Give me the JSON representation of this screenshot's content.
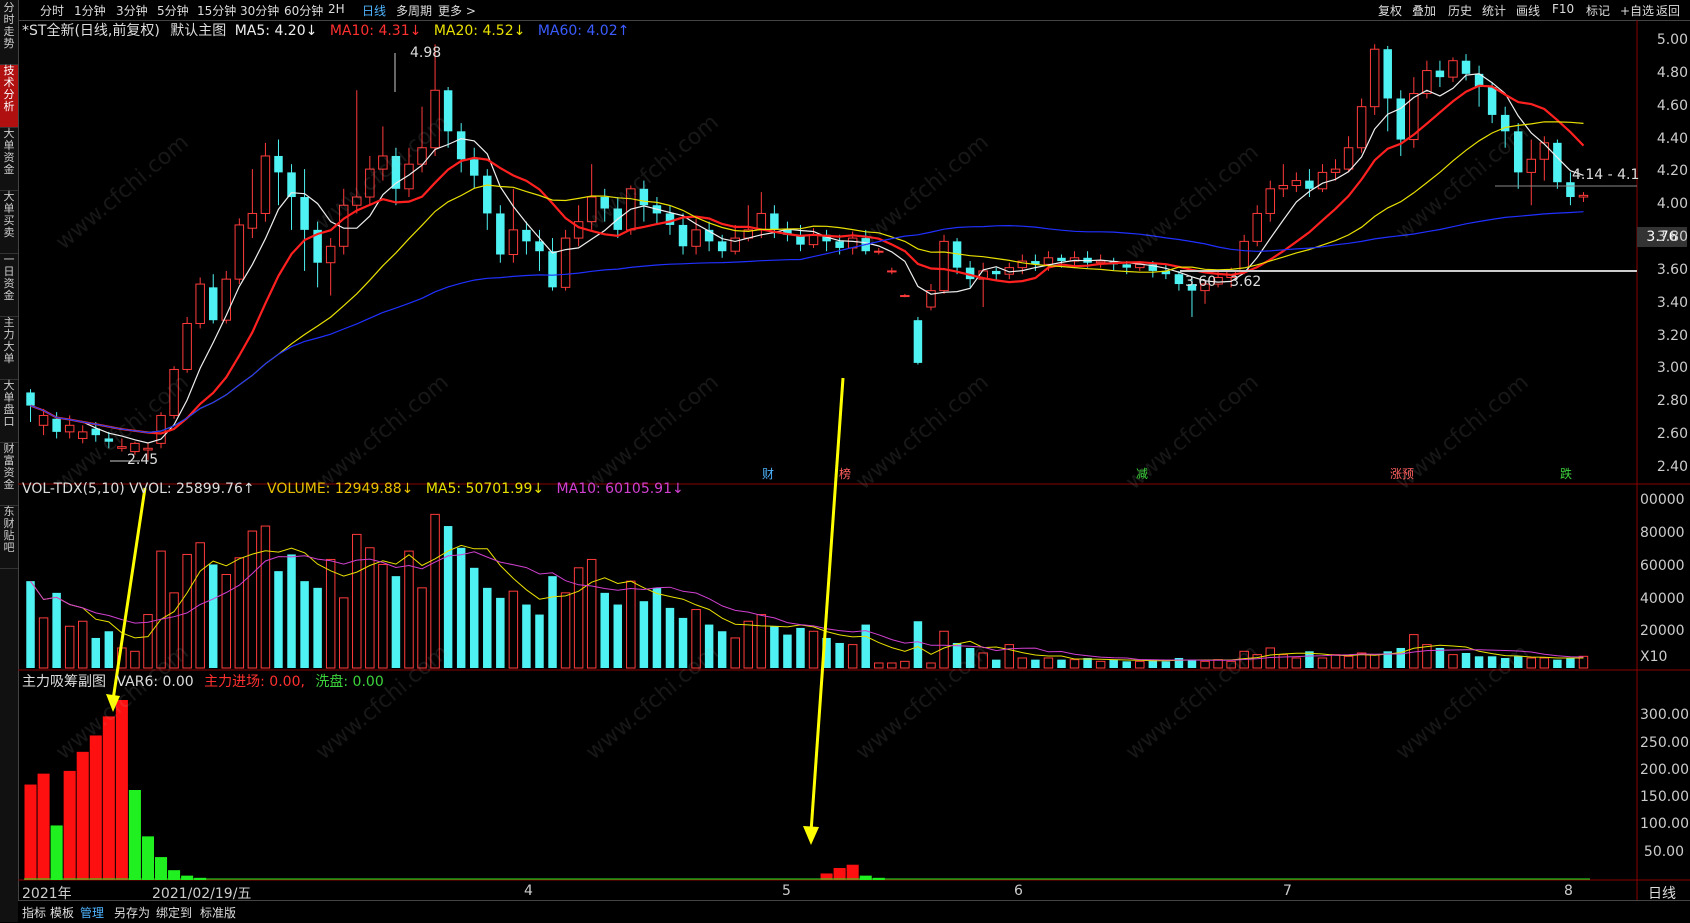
{
  "sidebar": {
    "items": [
      {
        "label": "分时走势",
        "active": false
      },
      {
        "label": "技术分析",
        "active": true
      },
      {
        "label": "大单资金",
        "active": false
      },
      {
        "label": "大单买卖",
        "active": false
      },
      {
        "label": "一日资金",
        "active": false
      },
      {
        "label": "主力大单",
        "active": false
      },
      {
        "label": "大单盘口",
        "active": false
      },
      {
        "label": "财富资金",
        "active": false
      },
      {
        "label": "东财贴吧",
        "active": false
      }
    ]
  },
  "topbar": {
    "periods": [
      "分时",
      "1分钟",
      "3分钟",
      "5分钟",
      "15分钟",
      "30分钟",
      "60分钟",
      "2H",
      "日线",
      "多周期",
      "更多 >"
    ],
    "active_period": "日线",
    "right_buttons": [
      "复权",
      "叠加",
      "历史",
      "统计",
      "画线",
      "F10",
      "标记",
      "+自选",
      "返回"
    ]
  },
  "main_panel": {
    "stock_title": "*ST全新(日线,前复权)",
    "indicator_name": "默认主图",
    "ma5": "MA5: 4.20↓",
    "ma10": "MA10: 4.31↓",
    "ma20": "MA20: 4.52↓",
    "ma60": "MA60: 4.02↑",
    "price_axis": [
      "5.00",
      "4.80",
      "4.60",
      "4.40",
      "4.20",
      "4.00",
      "3.80",
      "3.60",
      "3.40",
      "3.20",
      "3.00",
      "2.80",
      "2.60",
      "2.40"
    ],
    "current_price_tag": "3.76",
    "annotation_high": "4.98",
    "annotation_low": "2.45",
    "annotation_range1": "3.60 - 3.62",
    "annotation_range2": "4.14 - 4.1",
    "events": [
      {
        "label": "财",
        "color": "#4fb4ff"
      },
      {
        "label": "榜",
        "color": "#ff6060"
      },
      {
        "label": "减",
        "color": "#3cd23c"
      },
      {
        "label": "涨预",
        "color": "#ff6060"
      },
      {
        "label": "跌",
        "color": "#3cd23c"
      }
    ]
  },
  "volume_panel": {
    "title": "VOL-TDX(5,10)",
    "vvol": "VVOL: 25899.76↑",
    "volume": "VOLUME: 12949.88↓",
    "ma5": "MA5: 50701.99↓",
    "ma10": "MA10: 60105.91↓",
    "axis": [
      "00000",
      "80000",
      "60000",
      "40000",
      "20000",
      "X10"
    ]
  },
  "indicator_panel": {
    "title": "主力吸筹副图",
    "var6": "VAR6: 0.00",
    "main_entry": "主力进场: 0.00,",
    "wash": "洗盘: 0.00",
    "axis": [
      "300.00",
      "250.00",
      "200.00",
      "150.00",
      "100.00",
      "50.00"
    ]
  },
  "date_axis": {
    "labels": [
      "2021年",
      "2021/02/19/五",
      "4",
      "5",
      "6",
      "7",
      "8"
    ],
    "period_label": "日线"
  },
  "bottombar": {
    "items": [
      "指标",
      "模板",
      "管理",
      "另存为",
      "绑定到",
      "标准版"
    ],
    "active": "管理"
  },
  "watermark": "www.cfchi.com",
  "chart_data": {
    "type": "candlestick",
    "price_range": [
      2.4,
      5.0
    ],
    "candles": [
      [
        2.86,
        2.78,
        2.88,
        2.68
      ],
      [
        2.66,
        2.72,
        2.76,
        2.6
      ],
      [
        2.7,
        2.62,
        2.74,
        2.58
      ],
      [
        2.62,
        2.66,
        2.72,
        2.58
      ],
      [
        2.58,
        2.62,
        2.66,
        2.55
      ],
      [
        2.64,
        2.6,
        2.68,
        2.56
      ],
      [
        2.58,
        2.56,
        2.62,
        2.52
      ],
      [
        2.52,
        2.53,
        2.58,
        2.5
      ],
      [
        2.5,
        2.55,
        2.56,
        2.48
      ],
      [
        2.51,
        2.52,
        2.55,
        2.45
      ],
      [
        2.55,
        2.72,
        2.74,
        2.52
      ],
      [
        2.72,
        3.0,
        3.02,
        2.7
      ],
      [
        3.0,
        3.28,
        3.32,
        2.98
      ],
      [
        3.28,
        3.52,
        3.56,
        3.25
      ],
      [
        3.5,
        3.3,
        3.58,
        3.28
      ],
      [
        3.3,
        3.55,
        3.6,
        3.28
      ],
      [
        3.55,
        3.88,
        3.92,
        3.52
      ],
      [
        3.86,
        3.95,
        4.22,
        3.8
      ],
      [
        3.95,
        4.3,
        4.38,
        3.9
      ],
      [
        4.3,
        4.2,
        4.4,
        4.0
      ],
      [
        4.2,
        4.05,
        4.25,
        3.85
      ],
      [
        4.05,
        3.85,
        4.22,
        3.6
      ],
      [
        3.85,
        3.65,
        3.9,
        3.5
      ],
      [
        3.65,
        3.75,
        3.8,
        3.45
      ],
      [
        3.75,
        4.0,
        4.1,
        3.7
      ],
      [
        4.0,
        4.05,
        4.7,
        3.95
      ],
      [
        4.05,
        4.22,
        4.3,
        4.0
      ],
      [
        4.22,
        4.3,
        4.48,
        4.15
      ],
      [
        4.3,
        4.1,
        4.35,
        4.0
      ],
      [
        4.1,
        4.25,
        4.35,
        4.05
      ],
      [
        4.25,
        4.35,
        4.6,
        4.2
      ],
      [
        4.35,
        4.7,
        4.98,
        4.3
      ],
      [
        4.7,
        4.45,
        4.72,
        4.35
      ],
      [
        4.45,
        4.28,
        4.5,
        4.2
      ],
      [
        4.28,
        4.18,
        4.35,
        4.1
      ],
      [
        4.18,
        3.95,
        4.22,
        3.85
      ],
      [
        3.95,
        3.7,
        4.0,
        3.65
      ],
      [
        3.7,
        3.85,
        4.1,
        3.65
      ],
      [
        3.85,
        3.78,
        3.9,
        3.7
      ],
      [
        3.78,
        3.72,
        3.85,
        3.6
      ],
      [
        3.72,
        3.5,
        3.8,
        3.48
      ],
      [
        3.5,
        3.8,
        3.85,
        3.48
      ],
      [
        3.8,
        3.9,
        4.0,
        3.75
      ],
      [
        3.9,
        4.05,
        4.25,
        3.85
      ],
      [
        4.05,
        3.98,
        4.1,
        3.9
      ],
      [
        3.98,
        3.85,
        4.05,
        3.8
      ],
      [
        3.85,
        4.1,
        4.12,
        3.82
      ],
      [
        4.1,
        4.0,
        4.15,
        3.9
      ],
      [
        4.0,
        3.95,
        4.05,
        3.88
      ],
      [
        3.95,
        3.88,
        4.0,
        3.82
      ],
      [
        3.88,
        3.75,
        3.95,
        3.7
      ],
      [
        3.75,
        3.85,
        3.92,
        3.7
      ],
      [
        3.85,
        3.78,
        3.9,
        3.72
      ],
      [
        3.78,
        3.72,
        3.82,
        3.68
      ],
      [
        3.72,
        3.8,
        3.88,
        3.7
      ],
      [
        3.8,
        3.85,
        4.0,
        3.78
      ],
      [
        3.85,
        3.95,
        4.08,
        3.8
      ],
      [
        3.95,
        3.85,
        4.0,
        3.8
      ],
      [
        3.85,
        3.82,
        3.9,
        3.78
      ],
      [
        3.82,
        3.76,
        3.88,
        3.72
      ],
      [
        3.76,
        3.82,
        3.86,
        3.74
      ],
      [
        3.82,
        3.78,
        3.85,
        3.72
      ],
      [
        3.78,
        3.74,
        3.82,
        3.7
      ],
      [
        3.74,
        3.8,
        3.84,
        3.7
      ],
      [
        3.8,
        3.72,
        3.85,
        3.7
      ],
      [
        3.72,
        3.72,
        3.74,
        3.7
      ],
      [
        3.6,
        3.6,
        3.62,
        3.58
      ],
      [
        3.45,
        3.45,
        3.46,
        3.44
      ],
      [
        3.3,
        3.04,
        3.32,
        3.03
      ],
      [
        3.38,
        3.48,
        3.52,
        3.36
      ],
      [
        3.48,
        3.78,
        3.82,
        3.46
      ],
      [
        3.78,
        3.62,
        3.8,
        3.58
      ],
      [
        3.62,
        3.55,
        3.66,
        3.5
      ],
      [
        3.55,
        3.6,
        3.65,
        3.38
      ],
      [
        3.6,
        3.58,
        3.62,
        3.54
      ],
      [
        3.58,
        3.62,
        3.65,
        3.55
      ],
      [
        3.62,
        3.66,
        3.7,
        3.58
      ],
      [
        3.66,
        3.64,
        3.7,
        3.6
      ],
      [
        3.64,
        3.68,
        3.72,
        3.6
      ],
      [
        3.68,
        3.66,
        3.7,
        3.62
      ],
      [
        3.66,
        3.68,
        3.72,
        3.62
      ],
      [
        3.68,
        3.65,
        3.72,
        3.62
      ],
      [
        3.65,
        3.66,
        3.7,
        3.62
      ],
      [
        3.66,
        3.64,
        3.68,
        3.6
      ],
      [
        3.64,
        3.62,
        3.66,
        3.58
      ],
      [
        3.62,
        3.64,
        3.66,
        3.6
      ],
      [
        3.64,
        3.6,
        3.66,
        3.56
      ],
      [
        3.6,
        3.58,
        3.64,
        3.55
      ],
      [
        3.58,
        3.52,
        3.6,
        3.48
      ],
      [
        3.52,
        3.48,
        3.56,
        3.32
      ],
      [
        3.48,
        3.52,
        3.54,
        3.4
      ],
      [
        3.52,
        3.56,
        3.6,
        3.5
      ],
      [
        3.56,
        3.6,
        3.62,
        3.5
      ],
      [
        3.6,
        3.78,
        3.82,
        3.58
      ],
      [
        3.78,
        3.95,
        4.0,
        3.75
      ],
      [
        3.95,
        4.1,
        4.15,
        3.9
      ],
      [
        4.1,
        4.12,
        4.25,
        4.05
      ],
      [
        4.12,
        4.15,
        4.2,
        4.08
      ],
      [
        4.15,
        4.1,
        4.22,
        4.05
      ],
      [
        4.1,
        4.2,
        4.25,
        4.08
      ],
      [
        4.2,
        4.22,
        4.28,
        4.15
      ],
      [
        4.22,
        4.35,
        4.42,
        4.2
      ],
      [
        4.35,
        4.6,
        4.65,
        4.32
      ],
      [
        4.6,
        4.95,
        4.98,
        4.55
      ],
      [
        4.95,
        4.65,
        4.97,
        4.45
      ],
      [
        4.65,
        4.4,
        4.7,
        4.3
      ],
      [
        4.4,
        4.68,
        4.78,
        4.35
      ],
      [
        4.68,
        4.82,
        4.88,
        4.65
      ],
      [
        4.82,
        4.78,
        4.88,
        4.72
      ],
      [
        4.78,
        4.88,
        4.9,
        4.75
      ],
      [
        4.88,
        4.8,
        4.92,
        4.76
      ],
      [
        4.8,
        4.72,
        4.85,
        4.6
      ],
      [
        4.72,
        4.55,
        4.75,
        4.5
      ],
      [
        4.55,
        4.45,
        4.6,
        4.35
      ],
      [
        4.45,
        4.2,
        4.5,
        4.1
      ],
      [
        4.2,
        4.28,
        4.4,
        4.0
      ],
      [
        4.28,
        4.38,
        4.42,
        4.15
      ],
      [
        4.38,
        4.14,
        4.4,
        4.1
      ],
      [
        4.14,
        4.05,
        4.2,
        4.0
      ],
      [
        4.05,
        4.06,
        4.08,
        4.02
      ]
    ],
    "volume_range": [
      0,
      100000
    ],
    "volumes": [
      52000,
      30000,
      45000,
      25000,
      28000,
      18000,
      22000,
      12000,
      10000,
      32000,
      70000,
      45000,
      68000,
      75000,
      62000,
      56000,
      66000,
      82000,
      85000,
      58000,
      68000,
      52000,
      48000,
      65000,
      42000,
      80000,
      72000,
      62000,
      55000,
      70000,
      48000,
      92000,
      85000,
      72000,
      60000,
      48000,
      42000,
      46000,
      38000,
      32000,
      55000,
      45000,
      60000,
      65000,
      45000,
      38000,
      52000,
      40000,
      48000,
      36000,
      30000,
      35000,
      26000,
      22000,
      18000,
      28000,
      32000,
      25000,
      20000,
      24000,
      22000,
      18000,
      15000,
      14000,
      26000,
      3000,
      3000,
      4000,
      28000,
      3000,
      22000,
      15000,
      12000,
      9000,
      5000,
      14000,
      6000,
      5000,
      6000,
      5000,
      5000,
      6000,
      4000,
      5000,
      4000,
      4000,
      5000,
      4000,
      6000,
      5000,
      4000,
      5000,
      4000,
      10000,
      8000,
      12000,
      8000,
      6000,
      10000,
      6000,
      8000,
      7000,
      9000,
      8000,
      10000,
      12000,
      20000,
      14000,
      12000,
      8000,
      9000,
      7000,
      7000,
      6000,
      7000,
      6000,
      6000,
      5000,
      6000,
      7000
    ],
    "indicator_range": [
      0,
      330
    ],
    "indicator_bars": [
      {
        "x": 0,
        "h": 175,
        "c": "red"
      },
      {
        "x": 1,
        "h": 195,
        "c": "red"
      },
      {
        "x": 2,
        "h": 100,
        "c": "green"
      },
      {
        "x": 3,
        "h": 200,
        "c": "red"
      },
      {
        "x": 4,
        "h": 235,
        "c": "red"
      },
      {
        "x": 5,
        "h": 265,
        "c": "red"
      },
      {
        "x": 6,
        "h": 300,
        "c": "red"
      },
      {
        "x": 7,
        "h": 330,
        "c": "red"
      },
      {
        "x": 8,
        "h": 165,
        "c": "green"
      },
      {
        "x": 9,
        "h": 80,
        "c": "green"
      },
      {
        "x": 10,
        "h": 42,
        "c": "green"
      },
      {
        "x": 11,
        "h": 18,
        "c": "green"
      },
      {
        "x": 12,
        "h": 8,
        "c": "green"
      },
      {
        "x": 13,
        "h": 4,
        "c": "green"
      },
      {
        "x": 61,
        "h": 12,
        "c": "red"
      },
      {
        "x": 62,
        "h": 22,
        "c": "red"
      },
      {
        "x": 63,
        "h": 28,
        "c": "red"
      },
      {
        "x": 64,
        "h": 8,
        "c": "green"
      },
      {
        "x": 65,
        "h": 4,
        "c": "green"
      }
    ]
  }
}
